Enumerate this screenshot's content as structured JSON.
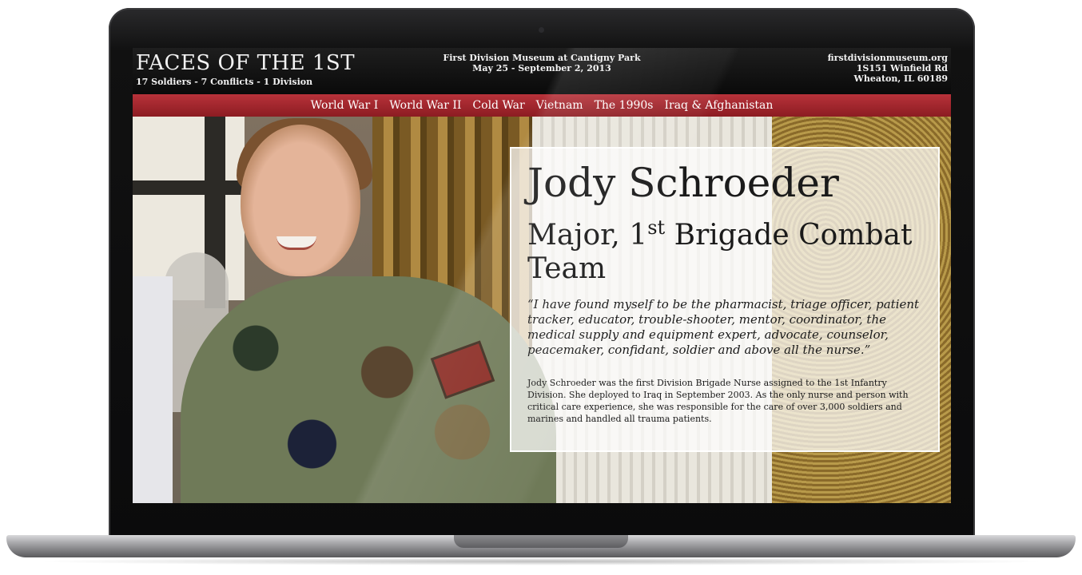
{
  "header": {
    "title": "FACES OF THE 1ST",
    "tagline": "17 Soldiers - 7 Conflicts - 1 Division",
    "exhibit_venue": "First Division Museum at Cantigny Park",
    "exhibit_dates": "May 25 - September 2, 2013",
    "website": "firstdivisionmuseum.org",
    "address_line1": "1S151 Winfield Rd",
    "address_line2": "Wheaton, IL 60189"
  },
  "nav": {
    "items": [
      {
        "label": "World War I"
      },
      {
        "label": "World War II"
      },
      {
        "label": "Cold War"
      },
      {
        "label": "Vietnam"
      },
      {
        "label": "The 1990s"
      },
      {
        "label": "Iraq & Afghanistan"
      }
    ]
  },
  "profile": {
    "name": "Jody Schroeder",
    "rank_prefix": "Major, 1",
    "rank_superscript": "st",
    "rank_suffix": " Brigade Combat Team",
    "quote": "“I have found myself to be the pharmacist, triage officer, patient tracker, educator, trouble-shooter, mentor, coordinator, the medical supply and equipment expert, advocate, counselor, peacemaker, confidant, soldier and above all the nurse.”",
    "bio": "Jody Schroeder was the first Division Brigade Nurse assigned to the 1st Infantry Division. She deployed to Iraq in September 2003. As the only nurse and person with critical care experience, she was responsible for the care of over 3,000 soldiers and marines and handled all trauma patients."
  },
  "colors": {
    "nav_red": "#a8262d",
    "header_black": "#111111"
  }
}
